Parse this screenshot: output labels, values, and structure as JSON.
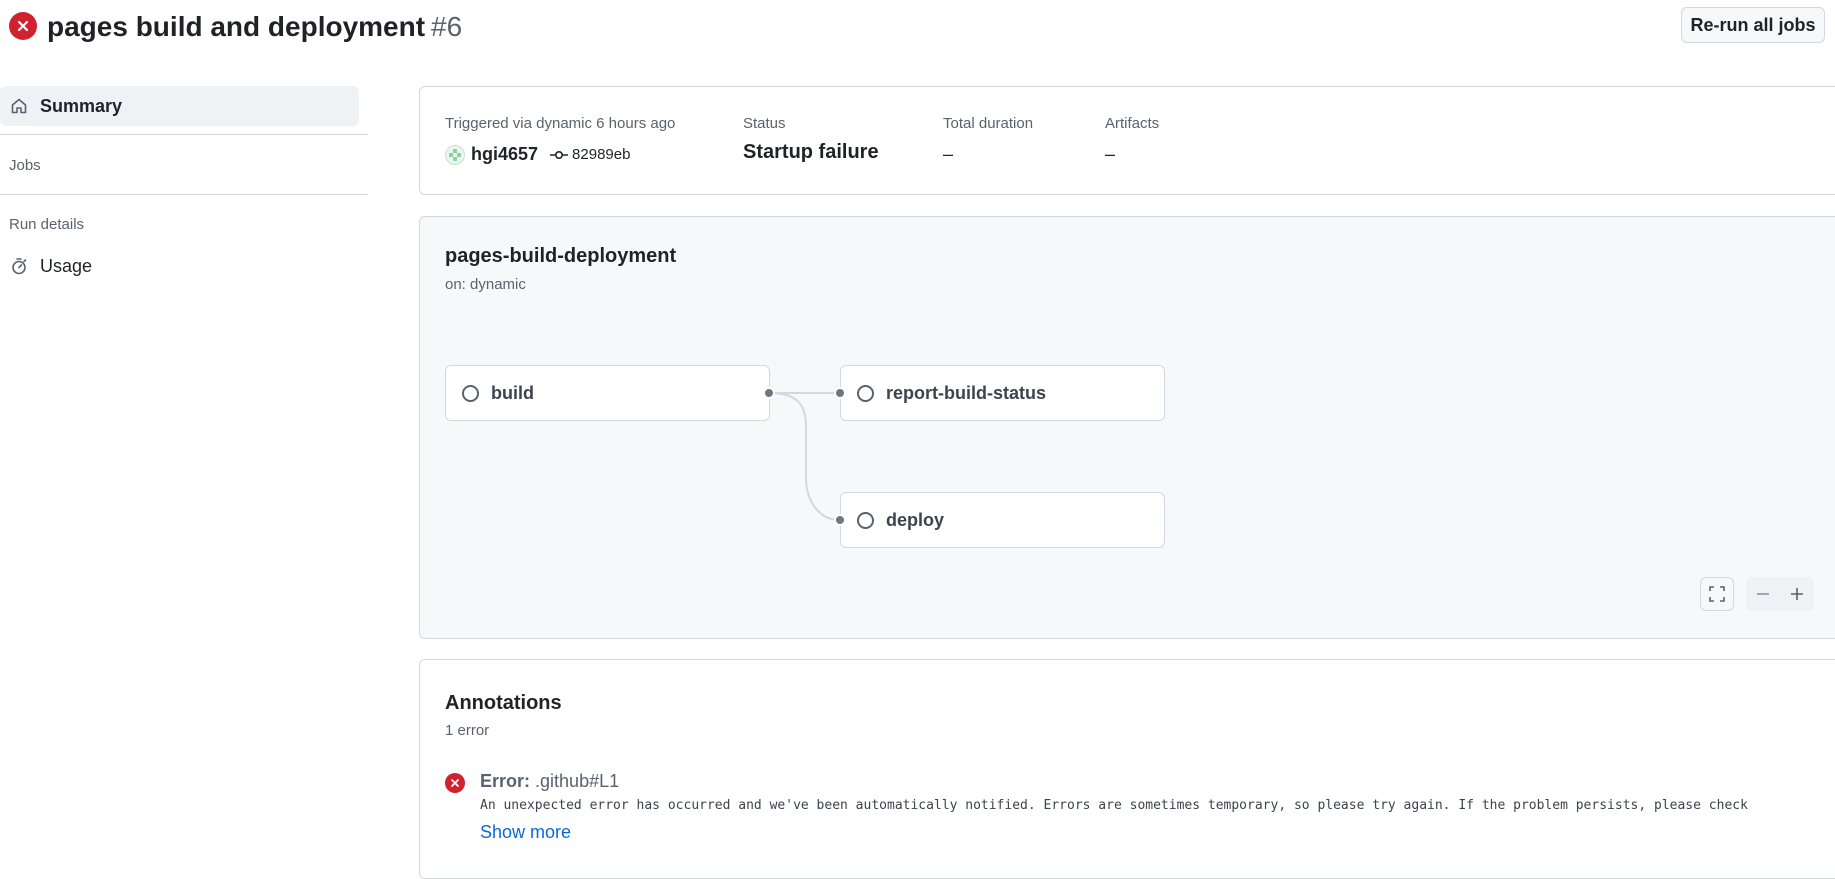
{
  "header": {
    "title": "pages build and deployment",
    "run_number": "#6",
    "rerun_label": "Re-run all jobs"
  },
  "sidebar": {
    "summary_label": "Summary",
    "jobs_heading": "Jobs",
    "run_details_heading": "Run details",
    "usage_label": "Usage"
  },
  "summary": {
    "triggered_label": "Triggered via dynamic 6 hours ago",
    "user": "hgi4657",
    "commit": "82989eb",
    "status_label": "Status",
    "status_value": "Startup failure",
    "duration_label": "Total duration",
    "duration_value": "–",
    "artifacts_label": "Artifacts",
    "artifacts_value": "–"
  },
  "workflow": {
    "name": "pages-build-deployment",
    "trigger": "on: dynamic",
    "jobs": {
      "build": "build",
      "report": "report-build-status",
      "deploy": "deploy"
    }
  },
  "annotations": {
    "title": "Annotations",
    "count": "1 error",
    "error_label": "Error:",
    "error_location": ".github#L1",
    "error_message": "An unexpected error has occurred and we've been automatically notified. Errors are sometimes temporary, so please try again. If the problem persists, please check",
    "show_more": "Show more"
  },
  "colors": {
    "error": "#cf222e",
    "link": "#0969da",
    "muted": "#59636e"
  }
}
